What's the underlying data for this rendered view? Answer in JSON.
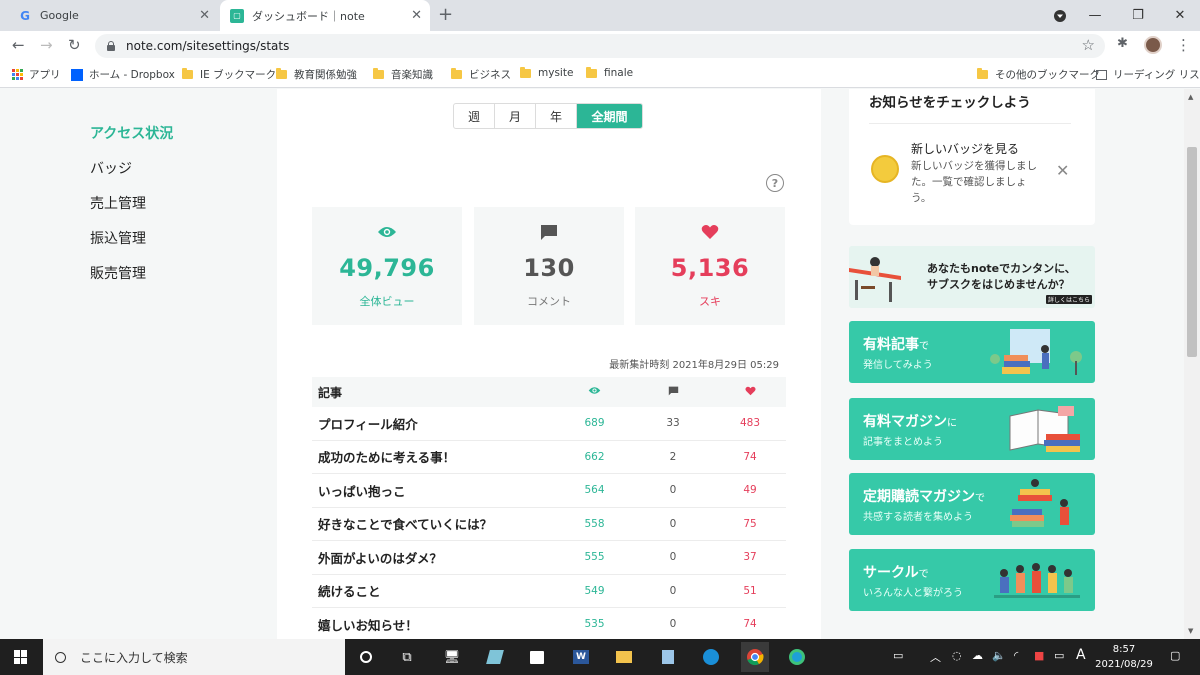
{
  "browser": {
    "tabs": [
      {
        "title": "Google",
        "favicon": "G"
      },
      {
        "title": "ダッシュボード｜note",
        "favicon": "note"
      }
    ],
    "url": "note.com/sitesettings/stats",
    "bookmarks": [
      "アプリ",
      "ホーム - Dropbox",
      "IE ブックマーク",
      "教育関係勉強",
      "音楽知識",
      "ビジネス",
      "mysite",
      "finale",
      "その他のブックマーク",
      "リーディング リスト"
    ]
  },
  "sidebar": {
    "items": [
      {
        "label": "アクセス状況",
        "active": true
      },
      {
        "label": "バッジ"
      },
      {
        "label": "売上管理"
      },
      {
        "label": "振込管理"
      },
      {
        "label": "販売管理"
      }
    ]
  },
  "periods": [
    "週",
    "月",
    "年",
    "全期間"
  ],
  "selected_period": "全期間",
  "help_label": "?",
  "summary": {
    "views": {
      "value": "49,796",
      "label": "全体ビュー",
      "color": "#2cb696"
    },
    "comments": {
      "value": "130",
      "label": "コメント",
      "color": "#555555"
    },
    "likes": {
      "value": "5,136",
      "label": "スキ",
      "color": "#e53e5b"
    }
  },
  "last_updated": "最新集計時刻 2021年8月29日 05:29",
  "table": {
    "header": "記事",
    "rows": [
      {
        "title": "プロフィール紹介",
        "views": "689",
        "comments": "33",
        "likes": "483"
      },
      {
        "title": "成功のために考える事！",
        "views": "662",
        "comments": "2",
        "likes": "74"
      },
      {
        "title": "いっぱい抱っこ",
        "views": "564",
        "comments": "0",
        "likes": "49"
      },
      {
        "title": "好きなことで食べていくには？",
        "views": "558",
        "comments": "0",
        "likes": "75"
      },
      {
        "title": "外面がよいのはダメ？",
        "views": "555",
        "comments": "0",
        "likes": "37"
      },
      {
        "title": "続けること",
        "views": "549",
        "comments": "0",
        "likes": "51"
      },
      {
        "title": "嬉しいお知らせ！",
        "views": "535",
        "comments": "0",
        "likes": "74"
      }
    ]
  },
  "notice": {
    "heading": "お知らせをチェックしよう",
    "title": "新しいバッジを見る",
    "desc": "新しいバッジを獲得しました。一覧で確認しましょう。"
  },
  "banners": {
    "subscribe": {
      "line1": "あなたもnoteでカンタンに、",
      "line2": "サブスクをはじめませんか？",
      "button": "詳しくはこちら"
    },
    "paid_article": {
      "main": "有料記事",
      "suffix": "で",
      "sub": "発信してみよう"
    },
    "paid_magazine": {
      "main": "有料マガジン",
      "suffix": "に",
      "sub": "記事をまとめよう"
    },
    "subscription_magazine": {
      "main": "定期購読マガジン",
      "suffix": "で",
      "sub": "共感する読者を集めよう"
    },
    "circle": {
      "main": "サークル",
      "suffix": "で",
      "sub": "いろんな人と繋がろう"
    }
  },
  "taskbar": {
    "search_placeholder": "ここに入力して検索",
    "ime": "A",
    "time": "8:57",
    "date": "2021/08/29"
  }
}
